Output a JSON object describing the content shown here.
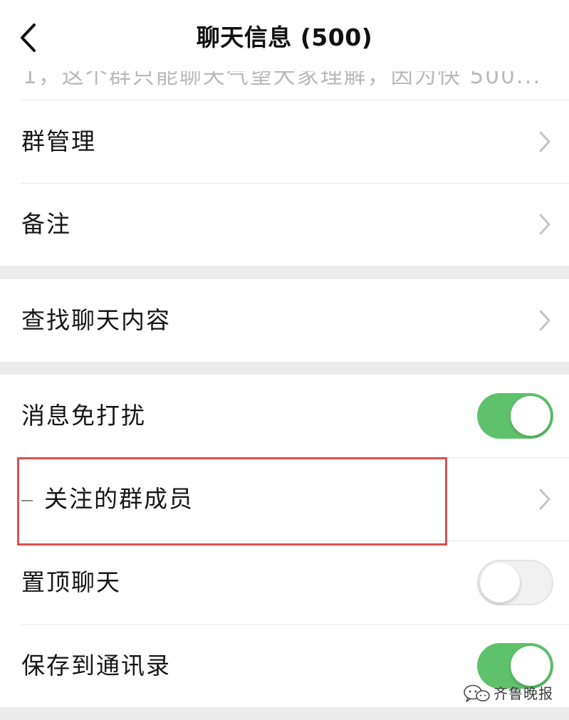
{
  "header": {
    "title": "聊天信息 (500)",
    "back_icon": "chevron-left-icon"
  },
  "announcement": {
    "text": "1，这个群只能聊天气望大家理解，因为快 500..."
  },
  "sections": [
    {
      "rows": [
        {
          "label": "群管理",
          "accessory": "chevron-right-icon"
        },
        {
          "label": "备注",
          "accessory": "chevron-right-icon"
        }
      ]
    },
    {
      "rows": [
        {
          "label": "查找聊天内容",
          "accessory": "chevron-right-icon"
        }
      ]
    },
    {
      "rows": [
        {
          "label": "消息免打扰",
          "accessory": "toggle",
          "toggle_on": true
        },
        {
          "label": "关注的群成员",
          "accessory": "chevron-right-icon",
          "highlighted": true
        },
        {
          "label": "置顶聊天",
          "accessory": "toggle",
          "toggle_on": false
        },
        {
          "label": "保存到通讯录",
          "accessory": "toggle",
          "toggle_on": true
        }
      ]
    }
  ],
  "watermark": {
    "text": "齐鲁晚报",
    "icon": "wechat-icon"
  },
  "colors": {
    "toggle_on": "#5ec26c",
    "toggle_off": "#f1f1f1",
    "highlight_border": "#d8514f",
    "section_gap": "#ececec",
    "chevron": "#c4c4c4"
  }
}
